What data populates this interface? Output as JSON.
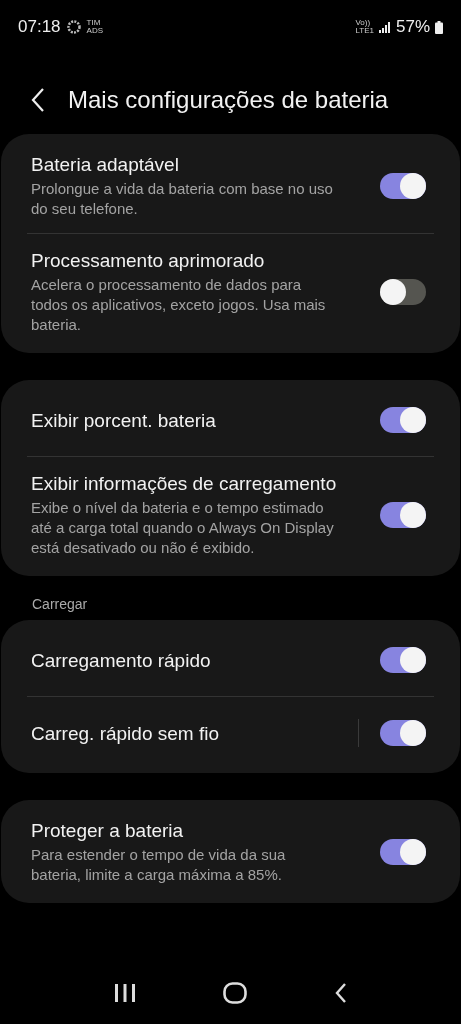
{
  "status_bar": {
    "time": "07:18",
    "carrier_top": "TIM",
    "carrier_bottom": "ADS",
    "volte_top": "Vo))",
    "volte_bottom": "LTE1",
    "battery": "57%"
  },
  "header": {
    "title": "Mais configurações de bateria"
  },
  "groups": [
    {
      "items": [
        {
          "kind": "switch",
          "title": "Bateria adaptável",
          "description": "Prolongue a vida da bateria com base no uso do seu telefone.",
          "on": true
        },
        {
          "kind": "switch",
          "title": "Processamento aprimorado",
          "description": "Acelera o processamento de dados para todos os aplicativos, exceto jogos. Usa mais bateria.",
          "on": false
        }
      ]
    },
    {
      "items": [
        {
          "kind": "switch",
          "title": "Exibir porcent. bateria",
          "on": true
        },
        {
          "kind": "switch",
          "title": "Exibir informações de carregamento",
          "description": "Exibe o nível da bateria e o tempo estimado até a carga total quando o Always On Display está desativado ou não é exibido.",
          "on": true
        }
      ]
    },
    {
      "label": "Carregar",
      "items": [
        {
          "kind": "switch",
          "title": "Carregamento rápido",
          "on": true
        },
        {
          "kind": "split-switch",
          "title": "Carreg. rápido sem fio",
          "on": true
        }
      ]
    },
    {
      "items": [
        {
          "kind": "switch",
          "title": "Proteger a bateria",
          "description": "Para estender o tempo de vida da sua bateria, limite a carga máxima a 85%.",
          "on": true
        }
      ]
    }
  ]
}
